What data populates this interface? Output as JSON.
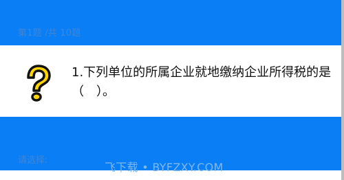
{
  "header": {
    "progress": "第1题 /共 10题"
  },
  "question": {
    "icon": "question-mark-icon",
    "text": "1.下列单位的所属企业就地缴纳企业所得税的是（　）。"
  },
  "answer": {
    "prompt": "请选择:"
  },
  "watermark": "飞下载 • BYFZXY.COM",
  "colors": {
    "primary": "#0a7ef5",
    "icon_fill": "#ffd400",
    "icon_outline": "#111111"
  }
}
